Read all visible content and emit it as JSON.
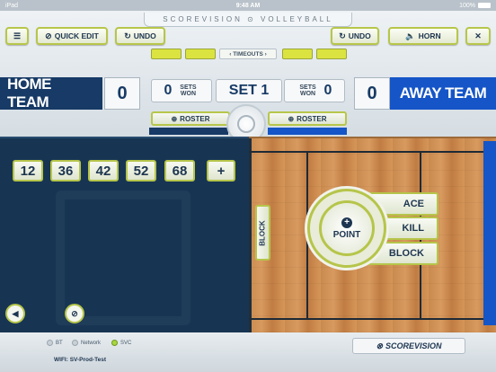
{
  "status_bar": {
    "carrier": "iPad",
    "time": "9:48 AM",
    "battery": "100%"
  },
  "brand": "SCOREVISION ⊙ VOLLEYBALL",
  "toolbar": {
    "quick_edit": "QUICK EDIT",
    "undo_left": "UNDO",
    "undo_right": "UNDO",
    "horn": "HORN"
  },
  "timeouts_label": "TIMEOUTS",
  "home": {
    "name": "HOME TEAM",
    "score": "0",
    "sets_won": "0"
  },
  "away": {
    "name": "AWAY TEAM",
    "score": "0",
    "sets_won": "0"
  },
  "sets_won_label": "SETS WON",
  "set_label": "SET 1",
  "roster_label": "ROSTER",
  "players": [
    "12",
    "36",
    "42",
    "52",
    "68"
  ],
  "add_player": "+",
  "actions": {
    "block_side": "BLOCK",
    "point": "POINT",
    "ace": "ACE",
    "kill": "KILL",
    "block": "BLOCK"
  },
  "footer": {
    "indicators": [
      {
        "label": "BT",
        "active": false
      },
      {
        "label": "Network",
        "active": false
      },
      {
        "label": "SVC",
        "active": true
      }
    ],
    "wifi": "WIFI: SV-Prod-Test",
    "logo": "SCOREVISION"
  },
  "colors": {
    "home": "#173a66",
    "away": "#1555c7",
    "accent": "#b7c64a",
    "timeout": "#dbe340"
  }
}
